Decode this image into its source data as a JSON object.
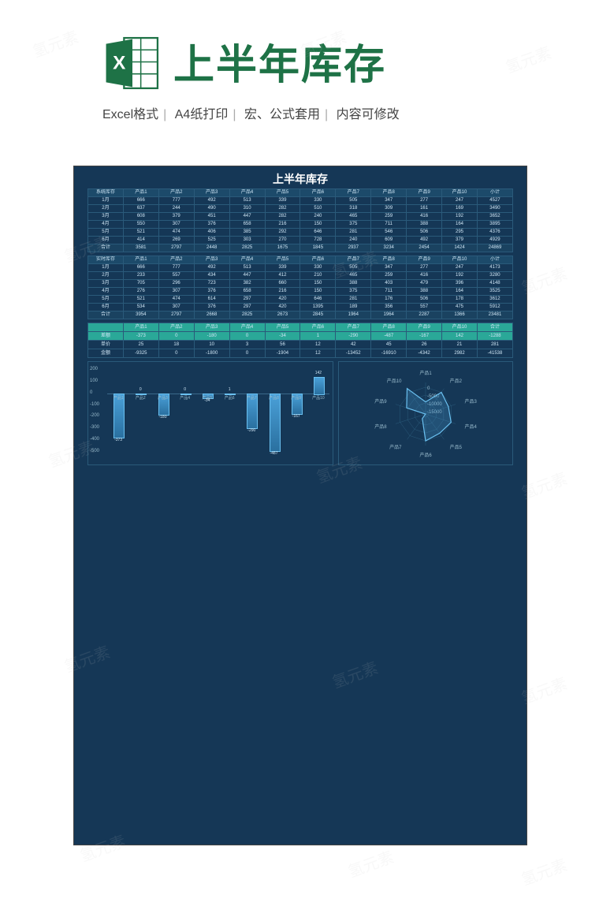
{
  "header": {
    "title": "上半年库存",
    "meta": [
      "Excel格式",
      "A4纸打印",
      "宏、公式套用",
      "内容可修改"
    ]
  },
  "doc": {
    "title": "上半年库存"
  },
  "products": [
    "产品1",
    "产品2",
    "产品3",
    "产品4",
    "产品5",
    "产品6",
    "产品7",
    "产品8",
    "产品9",
    "产品10"
  ],
  "months": [
    "1月",
    "2月",
    "3月",
    "4月",
    "5月",
    "6月"
  ],
  "table1": {
    "label": "系统库存",
    "total_label": "小计",
    "sum_label": "合计",
    "rows": [
      [
        666,
        777,
        492,
        513,
        339,
        330,
        505,
        347,
        277,
        247,
        4527
      ],
      [
        637,
        244,
        490,
        310,
        282,
        510,
        318,
        309,
        161,
        169,
        3490
      ],
      [
        608,
        379,
        451,
        447,
        282,
        240,
        465,
        259,
        416,
        192,
        3652
      ],
      [
        550,
        307,
        376,
        658,
        216,
        150,
        375,
        711,
        388,
        164,
        3895
      ],
      [
        521,
        474,
        406,
        385,
        292,
        646,
        281,
        546,
        506,
        295,
        4376
      ],
      [
        414,
        269,
        525,
        303,
        270,
        728,
        240,
        609,
        492,
        379,
        4929
      ],
      [
        3581,
        2797,
        2448,
        2825,
        1675,
        1845,
        2937,
        3234,
        2454,
        1424,
        24869
      ]
    ]
  },
  "table2": {
    "label": "实时库存",
    "total_label": "小计",
    "sum_label": "合计",
    "rows": [
      [
        666,
        777,
        492,
        513,
        339,
        330,
        505,
        347,
        277,
        247,
        4173
      ],
      [
        233,
        557,
        434,
        447,
        412,
        210,
        465,
        259,
        416,
        192,
        3280
      ],
      [
        705,
        296,
        723,
        382,
        660,
        150,
        388,
        403,
        479,
        396,
        4148
      ],
      [
        276,
        307,
        376,
        658,
        216,
        150,
        375,
        711,
        388,
        164,
        3525
      ],
      [
        521,
        474,
        614,
        297,
        420,
        646,
        281,
        176,
        506,
        178,
        3612
      ],
      [
        534,
        307,
        376,
        297,
        420,
        1395,
        189,
        356,
        557,
        475,
        5912
      ],
      [
        3954,
        2797,
        2668,
        2825,
        2673,
        2845,
        1964,
        1964,
        2287,
        1366,
        23481
      ]
    ]
  },
  "table3": {
    "labels": [
      "差额",
      "单价",
      "金额"
    ],
    "total_label": "合计",
    "rows": [
      [
        -373,
        0,
        -180,
        0,
        -34,
        1,
        -290,
        -487,
        -167,
        142,
        -1288
      ],
      [
        25,
        18,
        10,
        3,
        56,
        12,
        42,
        45,
        26,
        21,
        281
      ],
      [
        -9325,
        0,
        -1800,
        0,
        -1904,
        12,
        -13452,
        -16910,
        -4342,
        2982,
        -41538
      ]
    ]
  },
  "chart_data": [
    {
      "type": "bar",
      "title": "",
      "categories": [
        "产品1",
        "产品2",
        "产品3",
        "产品4",
        "产品5",
        "产品6",
        "产品7",
        "产品8",
        "产品9",
        "产品10"
      ],
      "values": [
        -373,
        0,
        -180,
        0,
        -34,
        1,
        -290,
        -487,
        -167,
        142
      ],
      "ylim": [
        -500,
        200
      ],
      "yticks": [
        200,
        100,
        0,
        -100,
        -200,
        -300,
        -400,
        -500
      ],
      "xlabel": "",
      "ylabel": ""
    },
    {
      "type": "radar",
      "title": "",
      "categories": [
        "产品1",
        "产品2",
        "产品3",
        "产品4",
        "产品5",
        "产品6",
        "产品7",
        "产品8",
        "产品9",
        "产品10"
      ],
      "values": [
        -9325,
        0,
        -1800,
        0,
        -1904,
        12,
        -13452,
        -16910,
        -4342,
        2982
      ],
      "rings": [
        0,
        -5000,
        -10000,
        -15000
      ]
    }
  ],
  "watermark": "氢元素"
}
